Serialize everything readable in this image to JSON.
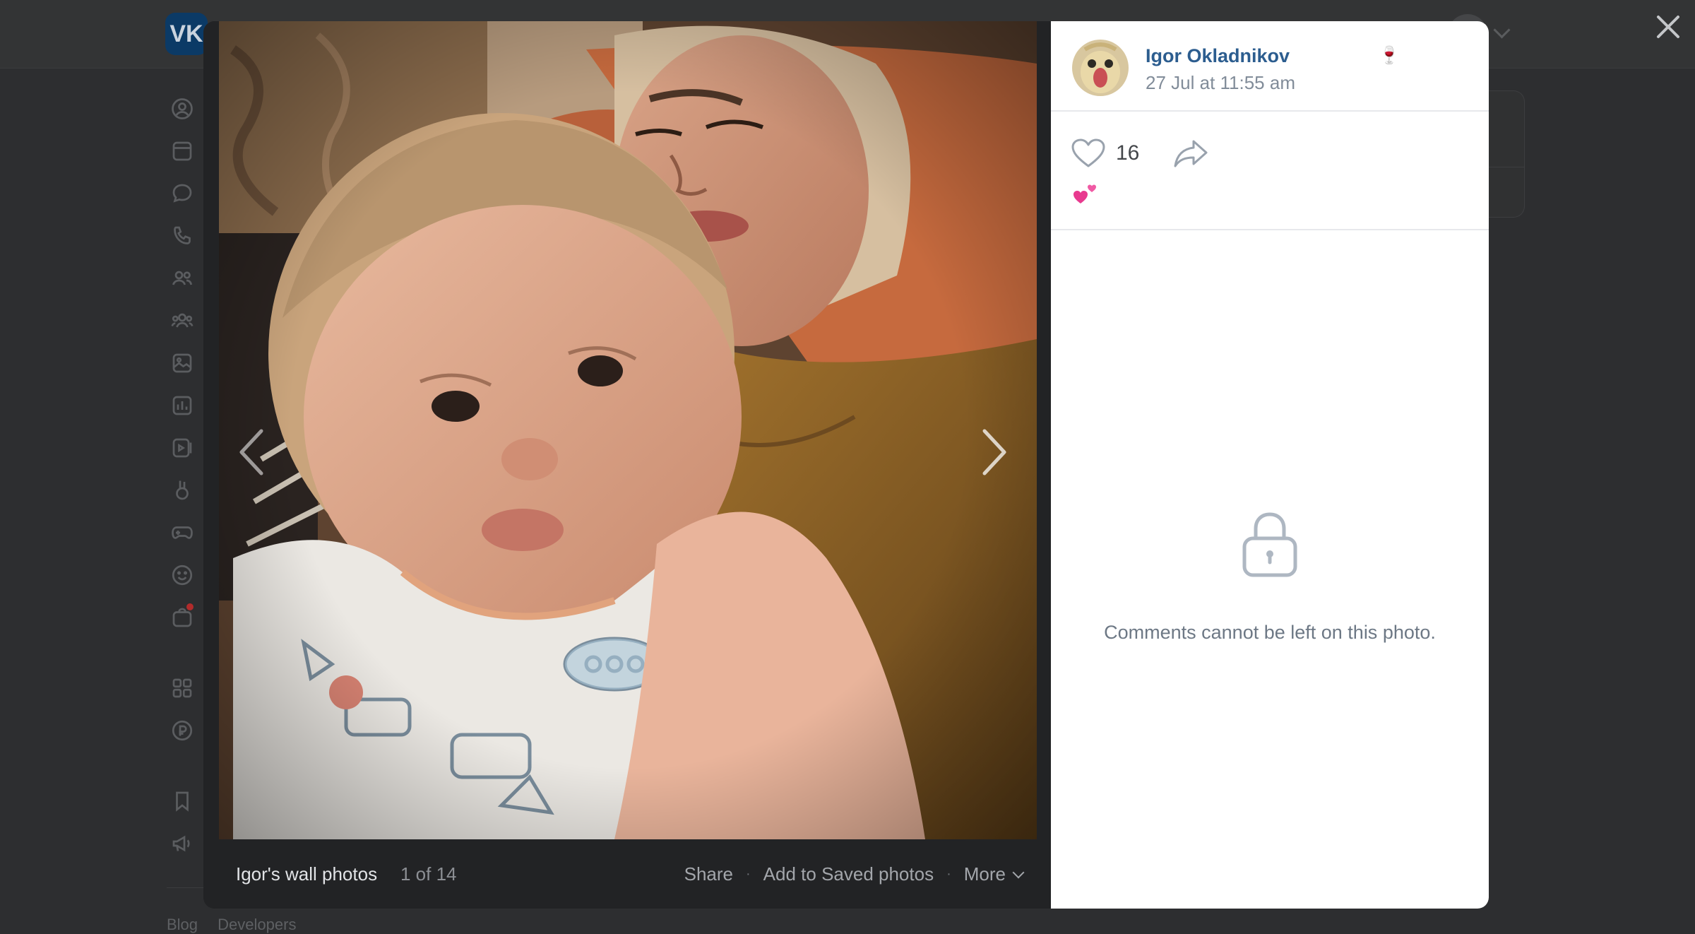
{
  "background": {
    "logo": "VK",
    "nav_icons": [
      "profile-icon",
      "news-icon",
      "messenger-icon",
      "calls-icon",
      "friends-icon",
      "communities-icon",
      "photos-icon",
      "music-icon",
      "videos-icon",
      "clips-icon",
      "games-icon",
      "stickers-icon",
      "market-icon",
      "services-icon",
      "vk-pay-icon",
      "bookmarks-icon",
      "ads-icon"
    ],
    "footer_links": [
      "Blog",
      "Developers"
    ]
  },
  "viewer": {
    "album_title": "Igor's wall photos",
    "photo_counter": "1 of 14",
    "actions": {
      "share": "Share",
      "save": "Add to Saved photos",
      "more": "More"
    },
    "separator": "·"
  },
  "post": {
    "author": "Igor Okladnikov",
    "author_emoji": "🍷",
    "date": "27 Jul at 11:55 am",
    "likes": "16",
    "reaction_emoji": "💕",
    "comments_disabled_text": "Comments cannot be left on this photo."
  },
  "colors": {
    "overlay": "#2d2e30",
    "link": "#2c5d8f",
    "meta": "#818c99"
  }
}
